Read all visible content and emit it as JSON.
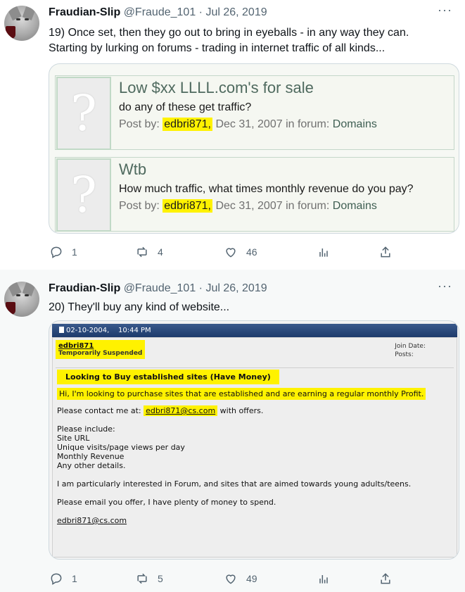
{
  "tweets": [
    {
      "author_name": "Fraudian-Slip",
      "meta": "@Fraude_101 · Jul 26, 2019",
      "more": "···",
      "text_line1": "19) Once set, then they go out to bring in eyeballs - in any way they can.",
      "text_line2": "Starting by lurking on forums - trading in internet traffic of all kinds...",
      "card": {
        "rows": [
          {
            "title": "Low $xx LLLL.com's for sale",
            "question": "do any of these get traffic?",
            "post_by": "Post by:",
            "user": "edbri871,",
            "date_forum": "Dec 31, 2007 in forum:",
            "forum": "Domains"
          },
          {
            "title": "Wtb",
            "question": "How much traffic, what times monthly revenue do you pay?",
            "post_by": "Post by:",
            "user": "edbri871,",
            "date_forum": "Dec 31, 2007 in forum:",
            "forum": "Domains"
          }
        ]
      },
      "actions": {
        "replies": "1",
        "retweets": "4",
        "likes": "46"
      }
    },
    {
      "author_name": "Fraudian-Slip",
      "meta": "@Fraude_101 · Jul 26, 2019",
      "more": "···",
      "text_line1": "20) They'll buy any kind of website...",
      "post": {
        "header": "02-10-2004,    10:44 PM",
        "username": "edbri871",
        "status": "Temporarily Suspended",
        "join_date": "Join Date:",
        "posts": "Posts:",
        "title": "Looking to Buy established sites (Have Money)",
        "intro": "Hi, I'm looking to purchase sites that are established and are earning a regular monthly Profit.",
        "contact_prefix": "Please contact me at:",
        "contact_email": "edbri871@cs.com",
        "contact_suffix": "with offers.",
        "include_heading": "Please include:",
        "include_items": [
          "Site URL",
          "Unique visits/page views per day",
          "Monthly Revenue",
          "Any other details."
        ],
        "interest": "I am particularly interested in Forum, and sites that are aimed towards young adults/teens.",
        "money": "Please email you offer, I have plenty of money to spend.",
        "signature_email": "edbri871@cs.com"
      },
      "actions": {
        "replies": "1",
        "retweets": "5",
        "likes": "49"
      }
    }
  ]
}
